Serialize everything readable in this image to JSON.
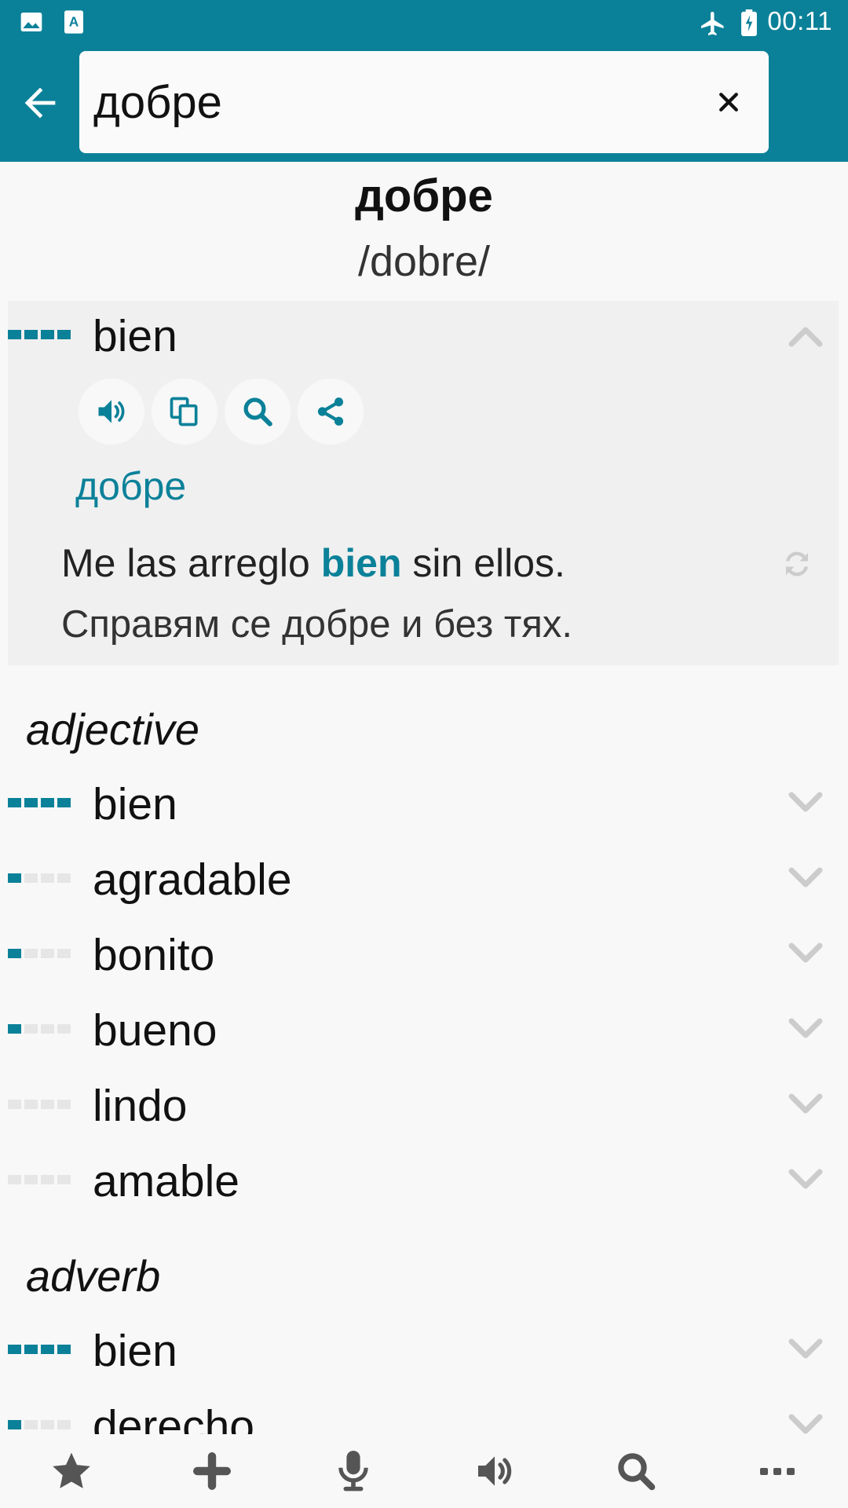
{
  "status_bar": {
    "time": "00:11",
    "icons": [
      "image-icon",
      "font-download-icon",
      "airplane-mode-icon",
      "battery-charging-icon"
    ]
  },
  "search": {
    "value": "добре",
    "clear_label": "×"
  },
  "entry": {
    "headword": "добре",
    "pronunciation": "/dobre/"
  },
  "expanded": {
    "word": "bien",
    "frequency": 4,
    "actions": [
      "speaker-icon",
      "copy-icon",
      "search-icon",
      "share-icon"
    ],
    "back_translation": "добре",
    "example_es_before": "Me las arreglo ",
    "example_es_highlight": "bien",
    "example_es_after": " sin ellos.",
    "example_bg": "Справям се добре и без тях."
  },
  "sections": [
    {
      "pos": "adjective",
      "items": [
        {
          "word": "bien",
          "frequency": 4
        },
        {
          "word": "agradable",
          "frequency": 1
        },
        {
          "word": "bonito",
          "frequency": 1
        },
        {
          "word": "bueno",
          "frequency": 1
        },
        {
          "word": "lindo",
          "frequency": 0
        },
        {
          "word": "amable",
          "frequency": 0
        }
      ]
    },
    {
      "pos": "adverb",
      "items": [
        {
          "word": "bien",
          "frequency": 4
        },
        {
          "word": "derecho",
          "frequency": 1
        }
      ]
    }
  ],
  "bottom_nav": [
    "star-icon",
    "plus-icon",
    "microphone-icon",
    "speaker-icon",
    "search-icon",
    "more-icon"
  ],
  "colors": {
    "accent": "#0b8199",
    "background": "#f8f8f8",
    "inactive_bar": "#e6e6e6",
    "chevron": "#cccccc",
    "nav_icon": "#555555"
  }
}
